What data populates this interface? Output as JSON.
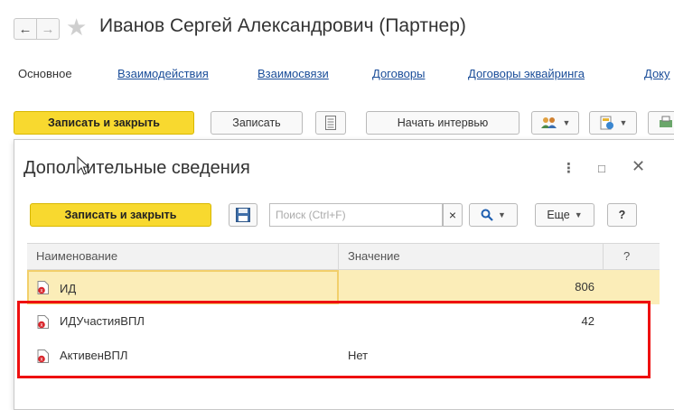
{
  "header": {
    "back_icon": "arrow-left-icon",
    "forward_icon": "arrow-right-icon",
    "favorite_icon": "star-icon",
    "title": "Иванов Сергей Александрович (Партнер)"
  },
  "tabs": [
    {
      "label": "Основное",
      "active": true
    },
    {
      "label": "Взаимодействия"
    },
    {
      "label": "Взаимосвязи"
    },
    {
      "label": "Договоры"
    },
    {
      "label": "Договоры эквайринга"
    },
    {
      "label": "Доку"
    }
  ],
  "toolbar": {
    "save_close_label": "Записать и закрыть",
    "save_label": "Записать",
    "list_icon": "document-list-icon",
    "start_interview_label": "Начать интервью",
    "users_icon": "users-icon",
    "report_icon": "report-icon",
    "extra_icon": "print-icon"
  },
  "subform": {
    "title": "Дополнительные сведения",
    "more_icon": "more-vertical-icon",
    "maximize_icon": "maximize-icon",
    "close_icon": "close-icon",
    "save_close_label": "Записать и закрыть",
    "save_icon": "floppy-disk-icon",
    "search_placeholder": "Поиск (Ctrl+F)",
    "clear_label": "×",
    "search_icon": "magnifier-icon",
    "more_label": "Еще",
    "help_label": "?"
  },
  "table": {
    "columns": [
      "Наименование",
      "Значение",
      "?"
    ],
    "rows": [
      {
        "name": "ИД",
        "value": "806",
        "align": "right",
        "selected": true
      },
      {
        "name": "ИДУчастияВПЛ",
        "value": "42",
        "align": "right"
      },
      {
        "name": "АктивенВПЛ",
        "value": "Нет",
        "align": "left"
      }
    ]
  },
  "colors": {
    "accent_yellow": "#f8d92f",
    "link_blue": "#1a4d99",
    "highlight_red": "#ee1010",
    "selected_row": "#fbedb8"
  }
}
